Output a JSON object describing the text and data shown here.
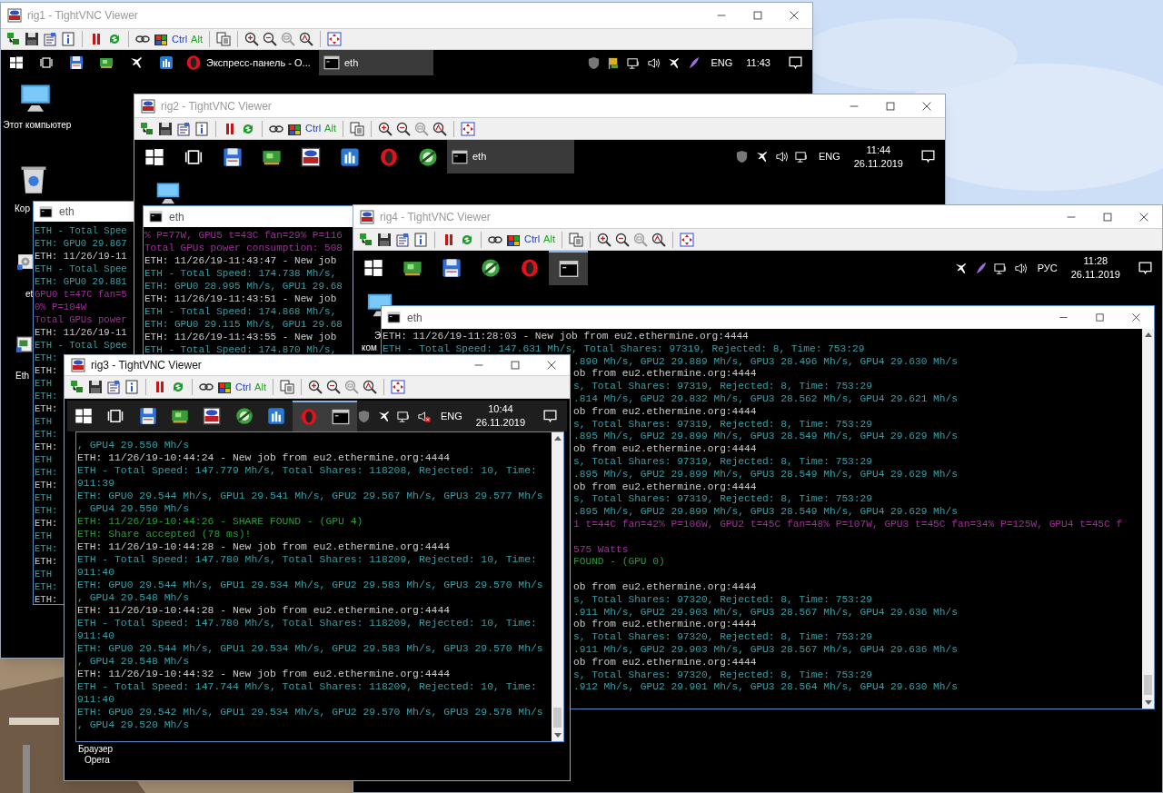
{
  "windows": [
    {
      "title": "rig1 - TightVNC Viewer",
      "active": false,
      "toolbar_keys": [
        "Ctrl",
        "Alt"
      ],
      "taskbar": {
        "icons": [
          {
            "kind": "start",
            "selected": false
          },
          {
            "kind": "taskview",
            "selected": false
          },
          {
            "kind": "floppy",
            "selected": false
          },
          {
            "kind": "card",
            "selected": false
          },
          {
            "kind": "plane",
            "selected": false
          },
          {
            "kind": "bars",
            "selected": false
          }
        ],
        "buttons": [
          {
            "kind": "opera",
            "label": "Экспресс-панель - О...",
            "selected": false
          },
          {
            "kind": "console",
            "label": "eth",
            "selected": true
          }
        ],
        "tray": [
          {
            "kind": "shield"
          },
          {
            "kind": "flag"
          },
          {
            "kind": "monitor"
          },
          {
            "kind": "speaker"
          },
          {
            "kind": "plane"
          },
          {
            "kind": "feather"
          }
        ],
        "lang": "ENG",
        "time": "11:43"
      },
      "desktop_icons": [
        {
          "kind": "computer",
          "label": "Этот компьютер"
        },
        {
          "kind": "bin",
          "label": "Кор"
        },
        {
          "kind": "gear",
          "label": "et"
        },
        {
          "kind": "window",
          "label": "Eth"
        }
      ],
      "console": {
        "title": "eth",
        "lines": [
          {
            "kind": "stat",
            "text": "ETH - Total Spee"
          },
          {
            "kind": "stat",
            "text": "ETH: GPU0 29.867"
          },
          {
            "kind": "job",
            "text": "ETH: 11/26/19-11"
          },
          {
            "kind": "stat",
            "text": "ETH - Total Spee"
          },
          {
            "kind": "stat",
            "text": "ETH: GPU0 29.881"
          },
          {
            "kind": "power",
            "text": "GPU0 t=47C fan=5"
          },
          {
            "kind": "power",
            "text": "0% P=104W"
          },
          {
            "kind": "power",
            "text": "Total GPUs power"
          },
          {
            "kind": "job",
            "text": "ETH: 11/26/19-11"
          },
          {
            "kind": "stat",
            "text": "ETH - Total Spee"
          },
          {
            "kind": "stat",
            "text": "ETH:"
          },
          {
            "kind": "job",
            "text": "ETH:"
          },
          {
            "kind": "stat",
            "text": "ETH"
          },
          {
            "kind": "stat",
            "text": "ETH:"
          },
          {
            "kind": "job",
            "text": "ETH:"
          },
          {
            "kind": "stat",
            "text": "ETH"
          },
          {
            "kind": "stat",
            "text": "ETH:"
          },
          {
            "kind": "job",
            "text": "ETH:"
          },
          {
            "kind": "stat",
            "text": "ETH"
          },
          {
            "kind": "stat",
            "text": "ETH:"
          },
          {
            "kind": "job",
            "text": "ETH:"
          },
          {
            "kind": "stat",
            "text": "ETH"
          },
          {
            "kind": "stat",
            "text": "ETH:"
          },
          {
            "kind": "job",
            "text": "ETH:"
          },
          {
            "kind": "stat",
            "text": "ETH"
          },
          {
            "kind": "stat",
            "text": "ETH:"
          },
          {
            "kind": "job",
            "text": "ETH:"
          },
          {
            "kind": "stat",
            "text": "ETH"
          },
          {
            "kind": "stat",
            "text": "ETH:"
          },
          {
            "kind": "job",
            "text": "ETH:"
          }
        ]
      }
    },
    {
      "title": "rig2 - TightVNC Viewer",
      "active": false,
      "toolbar_keys": [
        "Ctrl",
        "Alt"
      ],
      "taskbar": {
        "icons": [
          {
            "kind": "start",
            "selected": false
          },
          {
            "kind": "taskview",
            "selected": false
          },
          {
            "kind": "floppy",
            "selected": false
          },
          {
            "kind": "card",
            "selected": false
          },
          {
            "kind": "vnc",
            "selected": false
          },
          {
            "kind": "bars",
            "selected": false
          },
          {
            "kind": "opera",
            "selected": false
          },
          {
            "kind": "globe",
            "selected": false
          }
        ],
        "buttons": [
          {
            "kind": "console",
            "label": "eth",
            "selected": true
          }
        ],
        "tray": [
          {
            "kind": "shield"
          },
          {
            "kind": "plane"
          },
          {
            "kind": "speaker"
          },
          {
            "kind": "monitor"
          }
        ],
        "lang": "ENG",
        "time": "11:44",
        "date": "26.11.2019"
      },
      "desktop_icons": [
        {
          "kind": "computer"
        }
      ],
      "console": {
        "title": "eth",
        "lines": [
          {
            "kind": "power",
            "text": "% P=77W, GPU5 t=43C fan=29% P=116"
          },
          {
            "kind": "power",
            "text": "Total GPUs power consumption: 508"
          },
          {
            "kind": "job",
            "text": "ETH: 11/26/19-11:43:47 - New job"
          },
          {
            "kind": "stat",
            "text": "ETH - Total Speed: 174.738 Mh/s,"
          },
          {
            "kind": "stat",
            "text": "ETH: GPU0 28.995 Mh/s, GPU1 29.68"
          },
          {
            "kind": "job",
            "text": "ETH: 11/26/19-11:43:51 - New job"
          },
          {
            "kind": "stat",
            "text": "ETH - Total Speed: 174.868 Mh/s,"
          },
          {
            "kind": "stat",
            "text": "ETH: GPU0 29.115 Mh/s, GPU1 29.68"
          },
          {
            "kind": "job",
            "text": "ETH: 11/26/19-11:43:55 - New job"
          },
          {
            "kind": "stat",
            "text": "ETH - Total Speed: 174.870 Mh/s,"
          }
        ]
      }
    },
    {
      "title": "rig4 - TightVNC Viewer",
      "active": false,
      "toolbar_keys": [
        "Ctrl",
        "Alt"
      ],
      "taskbar": {
        "icons": [
          {
            "kind": "start",
            "selected": false
          },
          {
            "kind": "card",
            "selected": false
          },
          {
            "kind": "floppy",
            "selected": false
          },
          {
            "kind": "globe",
            "selected": false
          },
          {
            "kind": "opera",
            "selected": false
          },
          {
            "kind": "console",
            "selected": true
          }
        ],
        "tray": [
          {
            "kind": "plane"
          },
          {
            "kind": "feather"
          },
          {
            "kind": "monitor"
          },
          {
            "kind": "speaker"
          }
        ],
        "lang": "РУС",
        "time": "11:28",
        "date": "26.11.2019"
      },
      "desktop_icons": [
        {
          "kind": "computer"
        }
      ],
      "desktop_labels": [
        "Э",
        "ком"
      ],
      "console": {
        "title": "eth",
        "lines": [
          {
            "kind": "job",
            "text": "ETH: 11/26/19-11:28:03 - New job from eu2.ethermine.org:4444"
          },
          {
            "kind": "stat",
            "text": "ETH - Total Speed: 147.631 Mh/s, Total Shares: 97319, Rejected: 8, Time: 753:29"
          },
          {
            "kind": "stat",
            "text": ".890 Mh/s, GPU2 29.889 Mh/s, GPU3 28.496 Mh/s, GPU4 29.630 Mh/s"
          },
          {
            "kind": "job",
            "text": "ob from eu2.ethermine.org:4444"
          },
          {
            "kind": "stat",
            "text": "s, Total Shares: 97319, Rejected: 8, Time: 753:29"
          },
          {
            "kind": "stat",
            "text": ".814 Mh/s, GPU2 29.832 Mh/s, GPU3 28.562 Mh/s, GPU4 29.621 Mh/s"
          },
          {
            "kind": "job",
            "text": "ob from eu2.ethermine.org:4444"
          },
          {
            "kind": "stat",
            "text": "s, Total Shares: 97319, Rejected: 8, Time: 753:29"
          },
          {
            "kind": "stat",
            "text": ".895 Mh/s, GPU2 29.899 Mh/s, GPU3 28.549 Mh/s, GPU4 29.629 Mh/s"
          },
          {
            "kind": "job",
            "text": "ob from eu2.ethermine.org:4444"
          },
          {
            "kind": "stat",
            "text": "s, Total Shares: 97319, Rejected: 8, Time: 753:29"
          },
          {
            "kind": "stat",
            "text": ".895 Mh/s, GPU2 29.899 Mh/s, GPU3 28.549 Mh/s, GPU4 29.629 Mh/s"
          },
          {
            "kind": "job",
            "text": "ob from eu2.ethermine.org:4444"
          },
          {
            "kind": "stat",
            "text": "s, Total Shares: 97319, Rejected: 8, Time: 753:29"
          },
          {
            "kind": "stat",
            "text": ".895 Mh/s, GPU2 29.899 Mh/s, GPU3 28.549 Mh/s, GPU4 29.629 Mh/s"
          },
          {
            "kind": "power",
            "text": "1 t=44C fan=42% P=106W, GPU2 t=45C fan=48% P=107W, GPU3 t=45C fan=34% P=125W, GPU4 t=45C f"
          },
          {
            "kind": "gap"
          },
          {
            "kind": "power",
            "text": "575 Watts"
          },
          {
            "kind": "share",
            "text": "FOUND - (GPU 0)"
          },
          {
            "kind": "gap"
          },
          {
            "kind": "job",
            "text": "ob from eu2.ethermine.org:4444"
          },
          {
            "kind": "stat",
            "text": "s, Total Shares: 97320, Rejected: 8, Time: 753:29"
          },
          {
            "kind": "stat",
            "text": ".911 Mh/s, GPU2 29.903 Mh/s, GPU3 28.567 Mh/s, GPU4 29.636 Mh/s"
          },
          {
            "kind": "job",
            "text": "ob from eu2.ethermine.org:4444"
          },
          {
            "kind": "stat",
            "text": "s, Total Shares: 97320, Rejected: 8, Time: 753:29"
          },
          {
            "kind": "stat",
            "text": ".911 Mh/s, GPU2 29.903 Mh/s, GPU3 28.567 Mh/s, GPU4 29.636 Mh/s"
          },
          {
            "kind": "job",
            "text": "ob from eu2.ethermine.org:4444"
          },
          {
            "kind": "stat",
            "text": "s, Total Shares: 97320, Rejected: 8, Time: 753:29"
          },
          {
            "kind": "stat",
            "text": ".912 Mh/s, GPU2 29.901 Mh/s, GPU3 28.564 Mh/s, GPU4 29.630 Mh/s"
          }
        ]
      }
    },
    {
      "title": "rig3 - TightVNC Viewer",
      "active": true,
      "toolbar_keys": [
        "Ctrl",
        "Alt"
      ],
      "taskbar": {
        "icons": [
          {
            "kind": "start",
            "selected": false
          },
          {
            "kind": "taskview",
            "selected": false
          },
          {
            "kind": "floppy",
            "selected": false
          },
          {
            "kind": "card",
            "selected": false
          },
          {
            "kind": "vnc",
            "selected": false
          },
          {
            "kind": "globe",
            "selected": false
          },
          {
            "kind": "bars",
            "selected": false
          },
          {
            "kind": "opera",
            "selected": true
          },
          {
            "kind": "console",
            "selected": true
          }
        ],
        "tray": [
          {
            "kind": "shield"
          },
          {
            "kind": "plane"
          },
          {
            "kind": "monitor"
          },
          {
            "kind": "muted"
          }
        ],
        "lang": "ENG",
        "time": "10:44",
        "date": "26.11.2019"
      },
      "desktop_labels": [
        "Браузер",
        "Opera"
      ],
      "console": {
        "lines": [
          {
            "kind": "stat",
            "text": ", GPU4 29.550 Mh/s"
          },
          {
            "kind": "job",
            "text": "ETH: 11/26/19-10:44:24 - New job from eu2.ethermine.org:4444"
          },
          {
            "kind": "stat",
            "text": "ETH - Total Speed: 147.779 Mh/s, Total Shares: 118208, Rejected: 10, Time:"
          },
          {
            "kind": "stat",
            "text": "911:39"
          },
          {
            "kind": "stat",
            "text": "ETH: GPU0 29.544 Mh/s, GPU1 29.541 Mh/s, GPU2 29.567 Mh/s, GPU3 29.577 Mh/s"
          },
          {
            "kind": "stat",
            "text": ", GPU4 29.550 Mh/s"
          },
          {
            "kind": "share",
            "text": "ETH: 11/26/19-10:44:26 - SHARE FOUND - (GPU 4)"
          },
          {
            "kind": "share",
            "text": "ETH: Share accepted (78 ms)!"
          },
          {
            "kind": "job",
            "text": "ETH: 11/26/19-10:44:28 - New job from eu2.ethermine.org:4444"
          },
          {
            "kind": "stat",
            "text": "ETH - Total Speed: 147.780 Mh/s, Total Shares: 118209, Rejected: 10, Time:"
          },
          {
            "kind": "stat",
            "text": "911:40"
          },
          {
            "kind": "stat",
            "text": "ETH: GPU0 29.544 Mh/s, GPU1 29.534 Mh/s, GPU2 29.583 Mh/s, GPU3 29.570 Mh/s"
          },
          {
            "kind": "stat",
            "text": ", GPU4 29.548 Mh/s"
          },
          {
            "kind": "job",
            "text": "ETH: 11/26/19-10:44:28 - New job from eu2.ethermine.org:4444"
          },
          {
            "kind": "stat",
            "text": "ETH - Total Speed: 147.780 Mh/s, Total Shares: 118209, Rejected: 10, Time:"
          },
          {
            "kind": "stat",
            "text": "911:40"
          },
          {
            "kind": "stat",
            "text": "ETH: GPU0 29.544 Mh/s, GPU1 29.534 Mh/s, GPU2 29.583 Mh/s, GPU3 29.570 Mh/s"
          },
          {
            "kind": "stat",
            "text": ", GPU4 29.548 Mh/s"
          },
          {
            "kind": "job",
            "text": "ETH: 11/26/19-10:44:32 - New job from eu2.ethermine.org:4444"
          },
          {
            "kind": "stat",
            "text": "ETH - Total Speed: 147.744 Mh/s, Total Shares: 118209, Rejected: 10, Time:"
          },
          {
            "kind": "stat",
            "text": "911:40"
          },
          {
            "kind": "stat",
            "text": "ETH: GPU0 29.542 Mh/s, GPU1 29.534 Mh/s, GPU2 29.570 Mh/s, GPU3 29.578 Mh/s"
          },
          {
            "kind": "stat",
            "text": ", GPU4 29.520 Mh/s"
          }
        ]
      }
    }
  ]
}
